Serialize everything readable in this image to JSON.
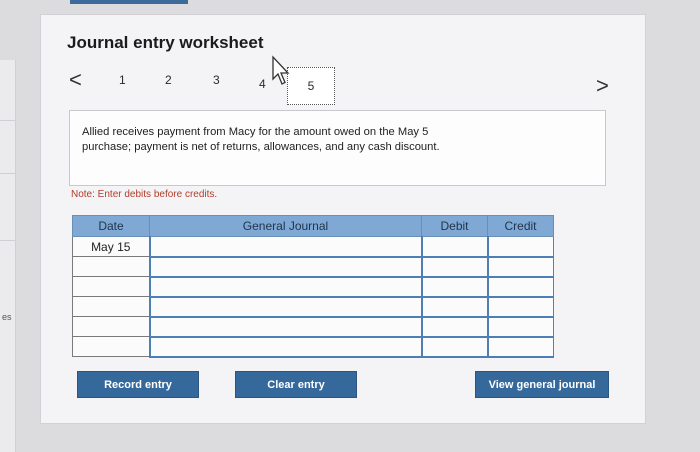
{
  "side_panel": {
    "label": "es"
  },
  "worksheet": {
    "title": "Journal entry worksheet",
    "nav": {
      "prev_icon": "chevron-left-icon",
      "next_icon": "chevron-right-icon",
      "prev_glyph": "<",
      "next_glyph": ">",
      "pages": [
        "1",
        "2",
        "3",
        "4",
        "5"
      ],
      "active_page": "5"
    },
    "description": {
      "line1": "Allied receives payment from Macy for the amount owed on the May 5",
      "line2": "purchase; payment is net of returns, allowances, and any cash discount."
    },
    "note": "Note: Enter debits before credits.",
    "table": {
      "headers": {
        "date": "Date",
        "journal": "General Journal",
        "debit": "Debit",
        "credit": "Credit"
      },
      "rows": [
        {
          "date": "May 15",
          "account": "",
          "debit": "",
          "credit": ""
        },
        {
          "date": "",
          "account": "",
          "debit": "",
          "credit": ""
        },
        {
          "date": "",
          "account": "",
          "debit": "",
          "credit": ""
        },
        {
          "date": "",
          "account": "",
          "debit": "",
          "credit": ""
        },
        {
          "date": "",
          "account": "",
          "debit": "",
          "credit": ""
        },
        {
          "date": "",
          "account": "",
          "debit": "",
          "credit": ""
        }
      ]
    },
    "buttons": {
      "record": "Record entry",
      "clear": "Clear entry",
      "view": "View general journal"
    }
  },
  "colors": {
    "button_bg": "#35689b",
    "header_bg": "#7fa9d4",
    "note_text": "#b23c2a"
  }
}
